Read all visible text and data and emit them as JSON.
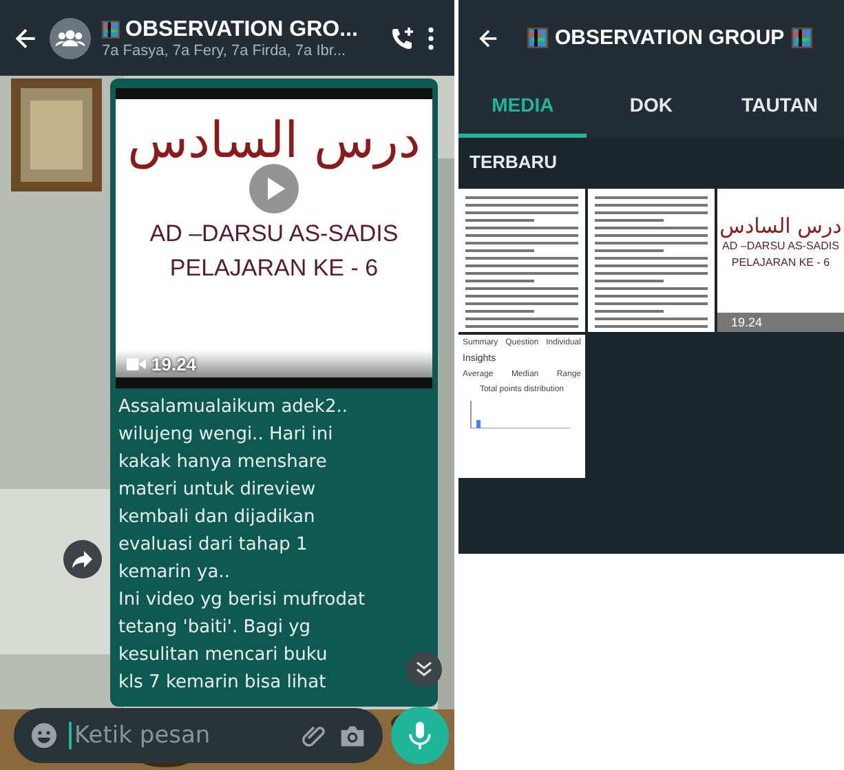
{
  "chat": {
    "title": "OBSERVATION GRO...",
    "subtitle": "7a Fasya, 7a Fery, 7a Firda, 7a Ibr...",
    "message": {
      "video": {
        "arabic": "درس السادس",
        "lines": [
          "AD –DARSU AS-SADIS",
          "PELAJARAN KE - 6"
        ],
        "duration": "19.24"
      },
      "text_lines": [
        "Assalamualaikum adek2..",
        "wilujeng wengi.. Hari ini",
        "kakak hanya menshare",
        "materi untuk direview",
        "kembali dan dijadikan",
        "evaluasi dari tahap 1",
        "kemarin ya..",
        "Ini video yg berisi mufrodat",
        "tetang 'baiti'. Bagi yg",
        "kesulitan mencari buku",
        "kls 7 kemarin bisa lihat"
      ]
    },
    "input": {
      "placeholder": "Ketik pesan"
    }
  },
  "media": {
    "title": "OBSERVATION GROUP",
    "tabs": [
      {
        "label": "MEDIA",
        "selected": true
      },
      {
        "label": "DOK",
        "selected": false
      },
      {
        "label": "TAUTAN",
        "selected": false
      }
    ],
    "section": "TERBARU",
    "items": [
      {
        "kind": "document"
      },
      {
        "kind": "document"
      },
      {
        "kind": "video",
        "arabic": "درس السادس",
        "lines": [
          "AD –DARSU AS-SADIS",
          "PELAJARAN KE - 6"
        ],
        "duration": "19.24"
      },
      {
        "kind": "form",
        "tabs": [
          "Summary",
          "Question",
          "Individual"
        ],
        "heading": "Insights",
        "stats": [
          "Average",
          "Median",
          "Range"
        ],
        "chart_title": "Total points distribution"
      }
    ]
  }
}
